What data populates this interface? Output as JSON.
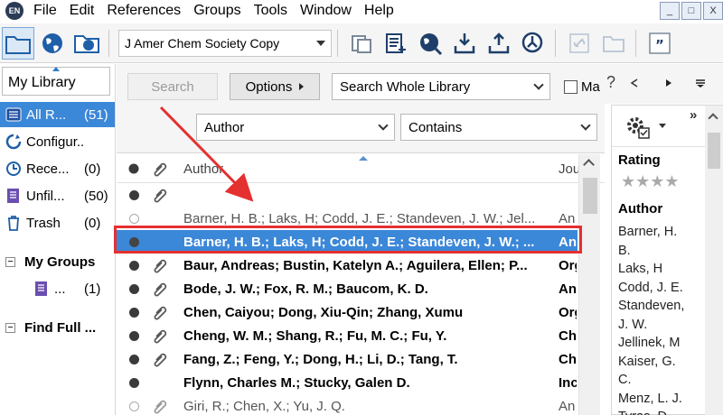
{
  "menubar": {
    "app_icon_label": "EN",
    "items": [
      "File",
      "Edit",
      "References",
      "Groups",
      "Tools",
      "Window",
      "Help"
    ],
    "window_buttons": [
      "_",
      "□",
      "X"
    ]
  },
  "toolbar": {
    "output_style": "J Amer Chem Society Copy",
    "icons": [
      "local-library-icon",
      "online-search-icon",
      "integrated-library-icon",
      "copy-formatted-icon",
      "new-reference-icon",
      "online-search-globe-icon",
      "import-icon",
      "export-icon",
      "find-full-text-icon",
      "open-link-icon",
      "open-file-icon",
      "insert-citation-icon"
    ],
    "quote_label": "”"
  },
  "left_pane": {
    "tab_label": "My Library",
    "groups": [
      {
        "name": "All R...",
        "count": "(51)",
        "icon": "all-references-icon"
      },
      {
        "name": "Configur...",
        "count": "",
        "icon": "configure-sync-icon"
      },
      {
        "name": "Rece...",
        "count": "(0)",
        "icon": "recently-added-icon"
      },
      {
        "name": "Unfil...",
        "count": "(50)",
        "icon": "unfiled-icon"
      },
      {
        "name": "Trash",
        "count": "(0)",
        "icon": "trash-icon"
      }
    ],
    "my_groups_label": "My Groups",
    "my_groups_item": {
      "name": "...",
      "count": "(1)"
    },
    "find_full_label": "Find Full ..."
  },
  "search": {
    "search_button": "Search",
    "options_button": "Options",
    "scope": "Search Whole Library",
    "match_case_label": "Ma",
    "field": "Author",
    "operator": "Contains"
  },
  "reference_list": {
    "headers": {
      "author": "Author",
      "journal": "Jou"
    },
    "rows": [
      {
        "author": "",
        "journal": "",
        "read": false,
        "attachment": true,
        "bold": true,
        "selected": false
      },
      {
        "author": "Barner, H. B.; Laks, H; Codd, J. E.; Standeven, J. W.; Jel...",
        "journal": "An",
        "read": true,
        "attachment": false,
        "bold": false,
        "selected": false
      },
      {
        "author": "Barner, H. B.; Laks, H; Codd, J. E.; Standeven, J. W.; ...",
        "journal": "An",
        "read": false,
        "attachment": false,
        "bold": true,
        "selected": true
      },
      {
        "author": "Baur, Andreas; Bustin, Katelyn A.; Aguilera, Ellen; P...",
        "journal": "Org",
        "read": false,
        "attachment": true,
        "bold": true,
        "selected": false
      },
      {
        "author": "Bode, J. W.; Fox, R. M.; Baucom, K. D.",
        "journal": "An",
        "read": false,
        "attachment": true,
        "bold": true,
        "selected": false
      },
      {
        "author": "Chen, Caiyou; Dong, Xiu-Qin; Zhang, Xumu",
        "journal": "Org",
        "read": false,
        "attachment": true,
        "bold": true,
        "selected": false
      },
      {
        "author": "Cheng, W. M.; Shang, R.; Fu, M. C.; Fu, Y.",
        "journal": "Che",
        "read": false,
        "attachment": true,
        "bold": true,
        "selected": false
      },
      {
        "author": "Fang, Z.; Feng, Y.; Dong, H.; Li, D.; Tang, T.",
        "journal": "Che",
        "read": false,
        "attachment": true,
        "bold": true,
        "selected": false
      },
      {
        "author": "Flynn, Charles M.; Stucky, Galen D.",
        "journal": "Inc",
        "read": false,
        "attachment": false,
        "bold": true,
        "selected": false
      },
      {
        "author": "Giri, R.; Chen, X.; Yu, J. Q.",
        "journal": "An",
        "read": true,
        "attachment": true,
        "bold": false,
        "selected": false
      }
    ]
  },
  "right_pane": {
    "rating_label": "Rating",
    "author_label": "Author",
    "stars": "★★★★",
    "author_lines": [
      "Barner, H.",
      "B.",
      "Laks, H",
      "Codd, J. E.",
      "Standeven,",
      "J. W.",
      "Jellinek, M",
      "Kaiser, G.",
      "C.",
      "Menz, L. J.",
      "Tyras, D."
    ],
    "double_chevron": "»",
    "help_mark": "?"
  },
  "colors": {
    "selection": "#3b87d8",
    "highlight_border": "#e53030",
    "arrow": "#e53030"
  }
}
